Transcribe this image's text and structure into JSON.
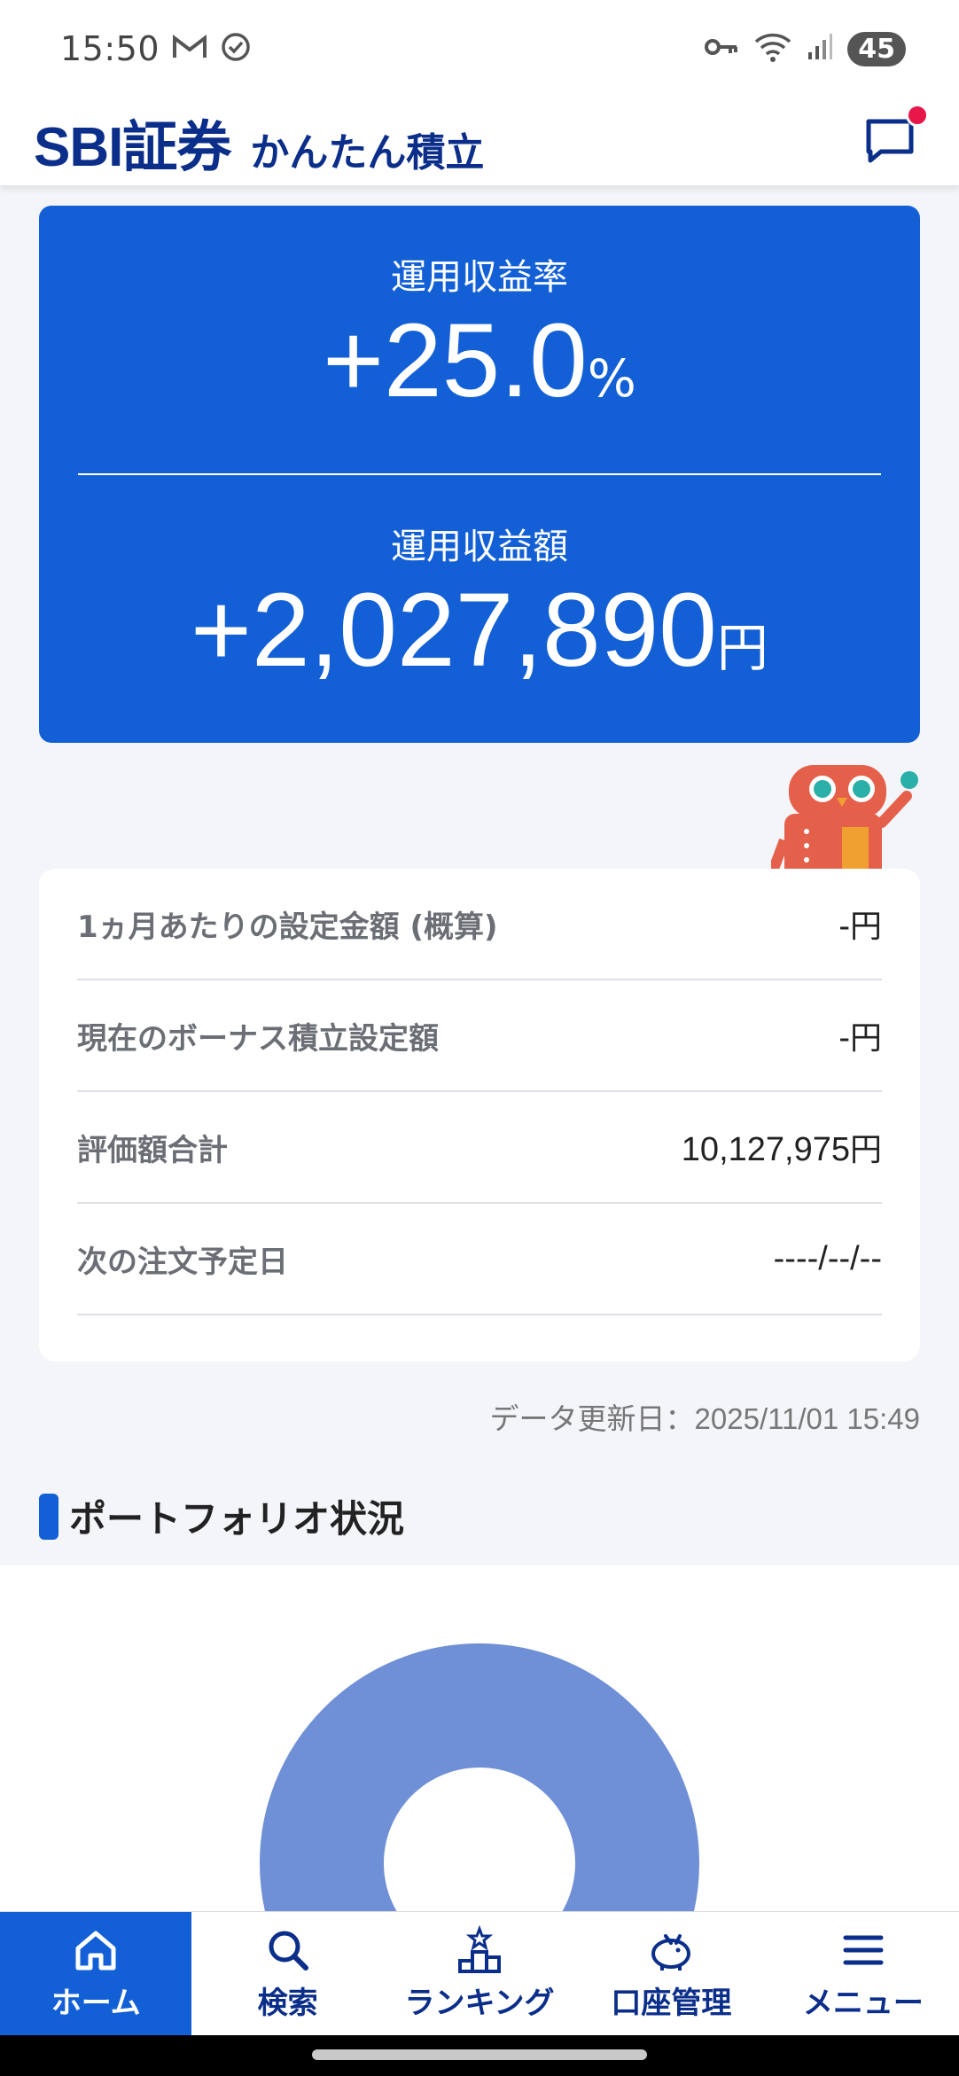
{
  "status_bar": {
    "time": "15:50",
    "battery": "45",
    "icons": [
      "gmail-icon",
      "check-circle-icon",
      "vpn-key-icon",
      "wifi-icon",
      "signal-icon"
    ]
  },
  "header": {
    "logo": "SBI証券",
    "subtitle": "かんたん積立",
    "brand_color": "#0b2e8a"
  },
  "summary": {
    "rate_label": "運用収益率",
    "rate_value": "+25.0",
    "rate_unit": "%",
    "amount_label": "運用収益額",
    "amount_value": "+2,027,890",
    "amount_unit": "円",
    "card_color": "#1360d6"
  },
  "info": {
    "rows": [
      {
        "label": "1ヵ月あたりの設定金額 (概算)",
        "value": "-",
        "unit": "円"
      },
      {
        "label": "現在のボーナス積立設定額",
        "value": "-",
        "unit": "円"
      },
      {
        "label": "評価額合計",
        "value": "10,127,975",
        "unit": "円"
      },
      {
        "label": "次の注文予定日",
        "value": "----/--/--",
        "unit": ""
      }
    ]
  },
  "update_note": "データ更新日：2025/11/01 15:49",
  "portfolio": {
    "title": "ポートフォリオ状況",
    "donut_color": "#6f8fd6"
  },
  "nav": {
    "items": [
      {
        "label": "ホーム",
        "icon": "home-icon"
      },
      {
        "label": "検索",
        "icon": "search-icon"
      },
      {
        "label": "ランキング",
        "icon": "ranking-icon"
      },
      {
        "label": "口座管理",
        "icon": "piggy-bank-icon"
      },
      {
        "label": "メニュー",
        "icon": "menu-icon"
      }
    ]
  }
}
